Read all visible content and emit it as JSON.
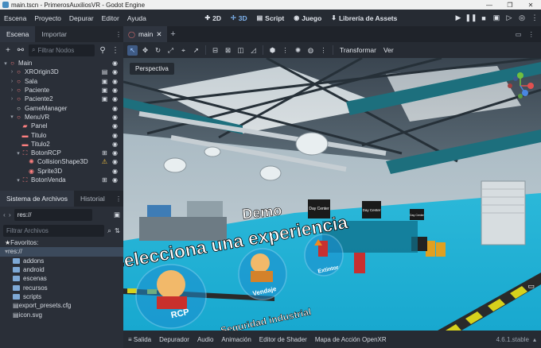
{
  "window": {
    "title": "main.tscn - PrimerosAuxiliosVR - Godot Engine",
    "controls": [
      "—",
      "❐",
      "✕"
    ]
  },
  "menu": {
    "items": [
      "Escena",
      "Proyecto",
      "Depurar",
      "Editor",
      "Ayuda"
    ],
    "workspaces": [
      {
        "icon": "2d-icon",
        "label": "2D"
      },
      {
        "icon": "3d-icon",
        "label": "3D"
      },
      {
        "icon": "script-icon",
        "label": "Script"
      },
      {
        "icon": "game-icon",
        "label": "Juego"
      },
      {
        "icon": "asset-library-icon",
        "label": "Librería de Assets"
      }
    ],
    "active_workspace": "3D"
  },
  "scene_dock": {
    "tabs": [
      "Escena",
      "Importar"
    ],
    "filter_placeholder": "Filtrar Nodos",
    "nodes": [
      {
        "label": "Main",
        "depth": 0,
        "arrow": "▾",
        "icon": "node3d-icon",
        "color": "#fc7f7f"
      },
      {
        "label": "XROrigin3D",
        "depth": 1,
        "arrow": "›",
        "icon": "node3d-icon",
        "color": "#fc7f7f"
      },
      {
        "label": "Sala",
        "depth": 1,
        "arrow": "›",
        "icon": "node3d-icon",
        "color": "#fc7f7f"
      },
      {
        "label": "Paciente",
        "depth": 1,
        "arrow": "›",
        "icon": "node3d-icon",
        "color": "#fc7f7f"
      },
      {
        "label": "Paciente2",
        "depth": 1,
        "arrow": "›",
        "icon": "node3d-icon",
        "color": "#fc7f7f"
      },
      {
        "label": "GameManager",
        "depth": 1,
        "arrow": "",
        "icon": "node-icon",
        "color": "#e0e0e0"
      },
      {
        "label": "MenuVR",
        "depth": 1,
        "arrow": "▾",
        "icon": "node3d-icon",
        "color": "#fc7f7f"
      },
      {
        "label": "Panel",
        "depth": 2,
        "arrow": "",
        "icon": "mesh-icon",
        "color": "#fc7f7f"
      },
      {
        "label": "Titulo",
        "depth": 2,
        "arrow": "",
        "icon": "label3d-icon",
        "color": "#fc7f7f"
      },
      {
        "label": "Titulo2",
        "depth": 2,
        "arrow": "",
        "icon": "label3d-icon",
        "color": "#fc7f7f"
      },
      {
        "label": "BotonRCP",
        "depth": 2,
        "arrow": "▾",
        "icon": "area3d-icon",
        "color": "#fc7f7f"
      },
      {
        "label": "CollisionShape3D",
        "depth": 3,
        "arrow": "",
        "icon": "collision-icon",
        "color": "#fc7f7f"
      },
      {
        "label": "Sprite3D",
        "depth": 3,
        "arrow": "",
        "icon": "sprite-icon",
        "color": "#fc7f7f"
      },
      {
        "label": "BotonVenda",
        "depth": 2,
        "arrow": "▾",
        "icon": "area3d-icon",
        "color": "#fc7f7f"
      }
    ]
  },
  "fs_dock": {
    "tabs": [
      "Sistema de Archivos",
      "Historial"
    ],
    "path": "res://",
    "filter_placeholder": "Filtrar Archivos",
    "items": [
      {
        "label": "Favoritos:",
        "kind": "favorites"
      },
      {
        "label": "res://",
        "kind": "root"
      },
      {
        "label": "addons",
        "kind": "folder"
      },
      {
        "label": "android",
        "kind": "folder"
      },
      {
        "label": "escenas",
        "kind": "folder"
      },
      {
        "label": "recursos",
        "kind": "folder"
      },
      {
        "label": "scripts",
        "kind": "folder"
      },
      {
        "label": "export_presets.cfg",
        "kind": "file"
      },
      {
        "label": "icon.svg",
        "kind": "file"
      }
    ]
  },
  "editor": {
    "tab": "main",
    "toolbar_labels": [
      "Transformar",
      "Ver"
    ],
    "viewport_label": "Perspectiva",
    "scene_text": {
      "demo": "Demo",
      "headline": "Selecciona una experiencia",
      "btn_rcp": "RCP",
      "btn_vendaje": "Vendaje",
      "btn_extintor": "Extintor",
      "subtitle": "Seguridad industrial",
      "sign1": "Day Center",
      "sign2": "Day Center",
      "sign3": "Day Center"
    }
  },
  "bottom_panel": {
    "items": [
      "Salida",
      "Depurador",
      "Audio",
      "Animación",
      "Editor de Shader",
      "Mapa de Acción OpenXR"
    ],
    "version": "4.6.1.stable"
  }
}
